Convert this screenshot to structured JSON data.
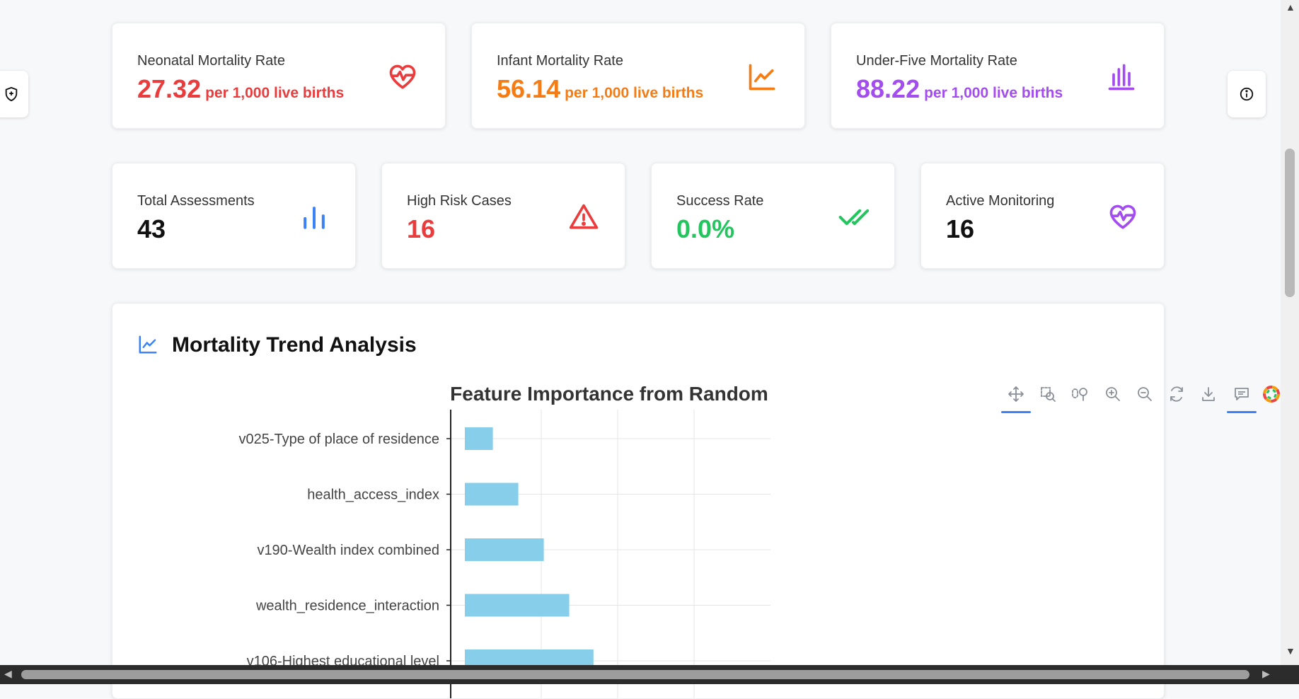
{
  "mortality_cards": [
    {
      "label": "Neonatal Mortality Rate",
      "value": "27.32",
      "unit": "per 1,000 live births",
      "color": "#ea3c3c",
      "icon": "heart-pulse-icon"
    },
    {
      "label": "Infant Mortality Rate",
      "value": "56.14",
      "unit": "per 1,000 live births",
      "color": "#f57c14",
      "icon": "line-chart-icon"
    },
    {
      "label": "Under-Five Mortality Rate",
      "value": "88.22",
      "unit": "per 1,000 live births",
      "color": "#a34df0",
      "icon": "bar-chart-icon"
    }
  ],
  "stat_cards": [
    {
      "label": "Total Assessments",
      "value": "43",
      "color": "#111111",
      "icon": "bar-chart-icon",
      "icon_color": "#3b82f6"
    },
    {
      "label": "High Risk Cases",
      "value": "16",
      "color": "#ea3c3c",
      "icon": "warning-icon",
      "icon_color": "#ea3c3c"
    },
    {
      "label": "Success Rate",
      "value": "0.0%",
      "color": "#22c55e",
      "icon": "double-check-icon",
      "icon_color": "#22c55e"
    },
    {
      "label": "Active Monitoring",
      "value": "16",
      "color": "#111111",
      "icon": "heart-pulse-icon",
      "icon_color": "#a34df0"
    }
  ],
  "trend_panel": {
    "title": "Mortality Trend Analysis",
    "icon": "line-chart-icon"
  },
  "toolbar": [
    "move-icon",
    "box-zoom-icon",
    "lasso-icon",
    "zoom-in-icon",
    "zoom-out-icon",
    "reset-icon",
    "download-icon",
    "comment-icon",
    "logo-icon"
  ],
  "chart_data": {
    "type": "bar",
    "orientation": "horizontal",
    "title": "Feature Importance from Random",
    "categories": [
      "v025-Type of place of residence",
      "health_access_index",
      "v190-Wealth index combined",
      "wealth_residence_interaction",
      "v106-Highest educational level"
    ],
    "values": [
      0.022,
      0.042,
      0.062,
      0.082,
      0.101
    ],
    "xlim": [
      0,
      0.24
    ],
    "grid": true,
    "bar_color": "#87ceeb"
  }
}
